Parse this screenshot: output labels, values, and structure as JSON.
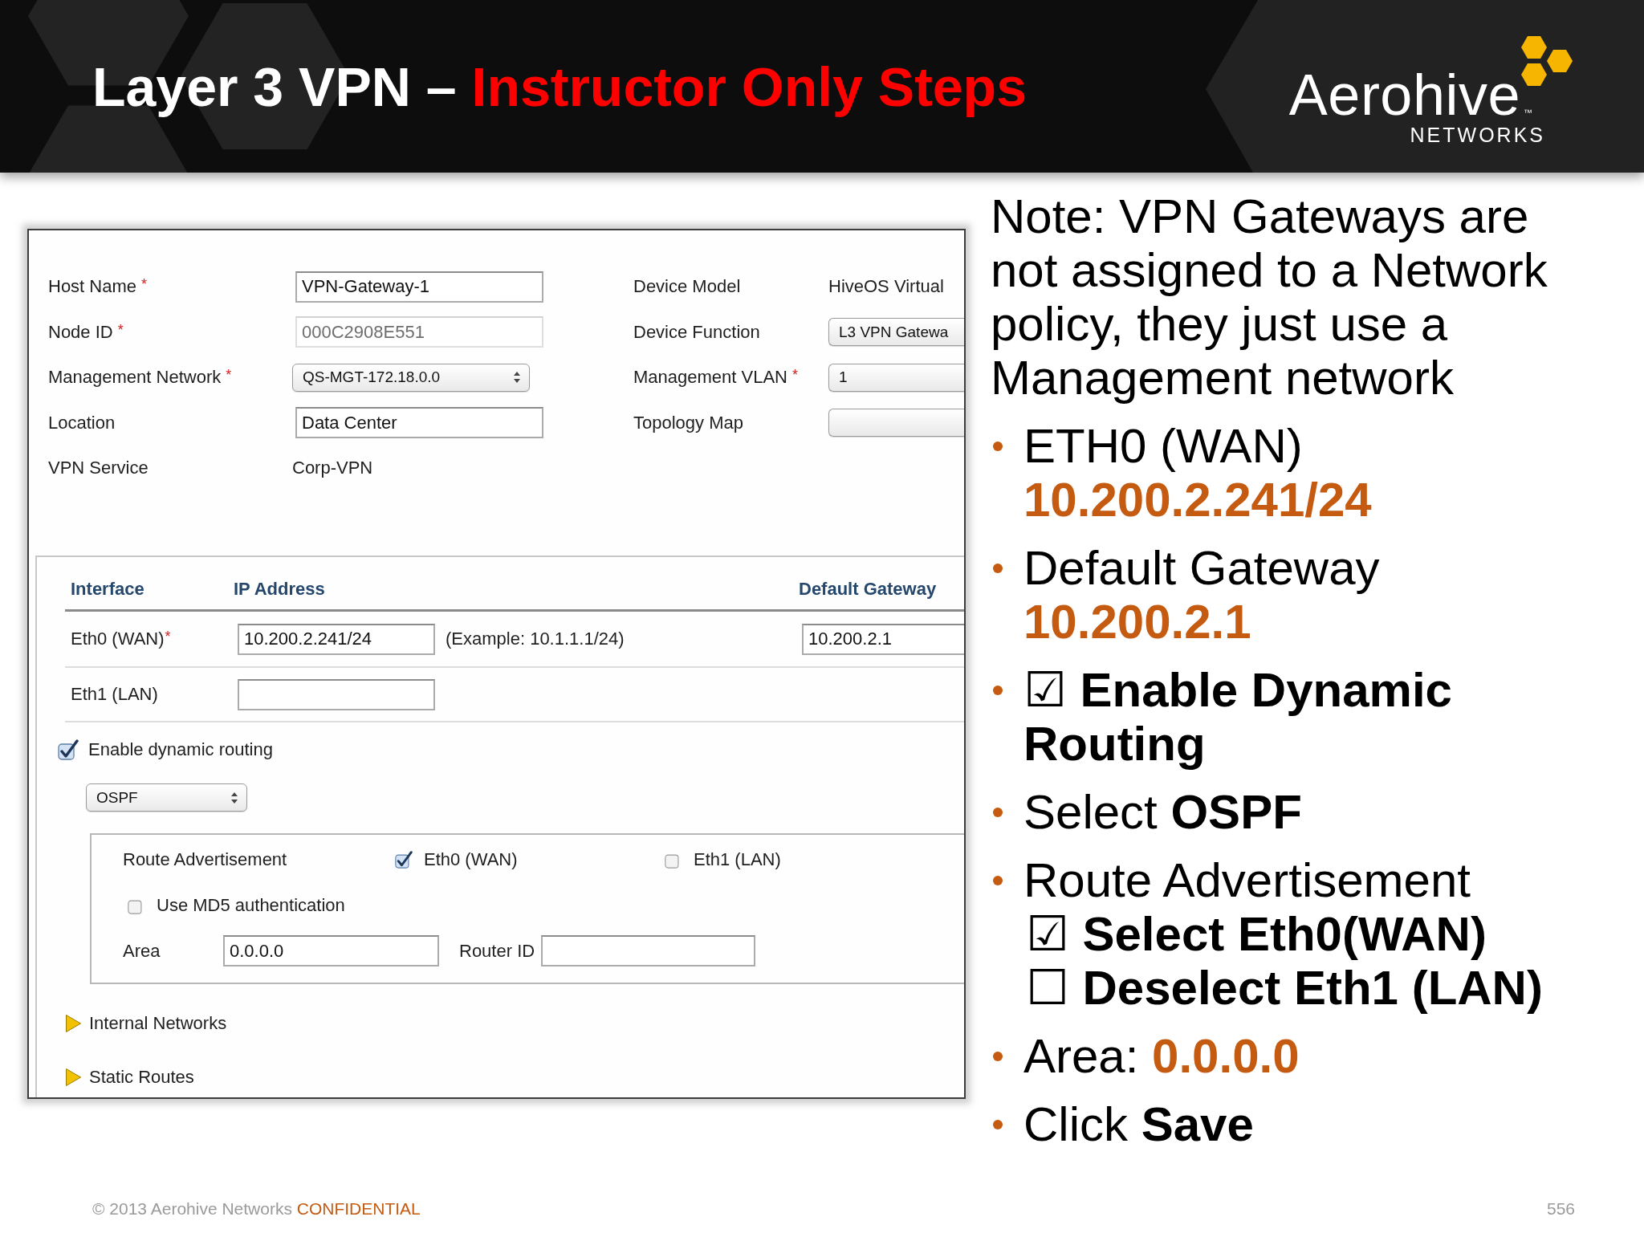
{
  "header": {
    "title": "Layer 3 VPN –",
    "highlight": "Instructor Only Steps"
  },
  "logo": {
    "name": "Aerohive",
    "trademark": "™",
    "subtitle": "NETWORKS"
  },
  "form": {
    "left_fields": [
      {
        "label": "Host Name",
        "required_mark": "*",
        "kind": "input",
        "value": "VPN-Gateway-1",
        "disabled": false
      },
      {
        "label": "Node ID",
        "required_mark": "*",
        "kind": "input",
        "value": "000C2908E551",
        "disabled": true
      },
      {
        "label": "Management Network",
        "required_mark": "*",
        "kind": "select",
        "value": "QS-MGT-172.18.0.0",
        "disabled": false
      },
      {
        "label": "Location",
        "kind": "input",
        "value": "Data Center",
        "disabled": false
      },
      {
        "label": "VPN Service",
        "kind": "text",
        "value": "Corp-VPN",
        "disabled": false
      }
    ],
    "right_fields": [
      {
        "label": "Device Model",
        "kind": "text",
        "value": "HiveOS Virtual",
        "disabled": false
      },
      {
        "label": "Device Function",
        "kind": "select",
        "value": "L3 VPN Gatewa",
        "disabled": false
      },
      {
        "label": "Management VLAN",
        "required_mark": "*",
        "kind": "select",
        "value": "1",
        "disabled": false
      },
      {
        "label": "Topology Map",
        "kind": "select",
        "disabled": false
      }
    ],
    "interfaces": {
      "columns": [
        "Interface",
        "IP Address",
        "Default Gateway"
      ],
      "rows": [
        {
          "kind": "wan",
          "name": "Eth0 (WAN)",
          "required_mark": "*",
          "ip": "10.200.2.241/24",
          "hint": "(Example: 10.1.1.1/24)",
          "gateway": "10.200.2.1"
        },
        {
          "kind": "lan",
          "name": "Eth1 (LAN)"
        }
      ]
    },
    "dynamic_routing": {
      "label": "Enable dynamic routing",
      "checked": true,
      "protocol": "OSPF",
      "route_advertisement": {
        "label": "Route Advertisement",
        "options": [
          {
            "label": "Eth0 (WAN)",
            "checked": true
          },
          {
            "label": "Eth1 (LAN)",
            "checked": false
          }
        ]
      },
      "md5": {
        "label": "Use MD5 authentication",
        "checked": false
      },
      "area": {
        "label": "Area",
        "value": "0.0.0.0"
      },
      "router_id": {
        "label": "Router ID"
      }
    },
    "sections": [
      {
        "label": "Internal Networks",
        "expanded": false
      },
      {
        "label": "Static Routes",
        "expanded": false
      }
    ]
  },
  "note": "Note: VPN Gateways are not assigned to a Network policy, they just use a Management network",
  "bullets": [
    {
      "kind": "value",
      "text": "ETH0 (WAN)",
      "value": "10.200.2.241/24"
    },
    {
      "kind": "value",
      "text": "Default Gateway",
      "value": "10.200.2.1"
    },
    {
      "kind": "bold",
      "text": "☑ Enable Dynamic Routing"
    },
    {
      "kind": "plain",
      "text": "Select **OSPF**"
    },
    {
      "kind": "list",
      "text": "Route Advertisement",
      "items": [
        "☑ Select Eth0(WAN)",
        "☐ Deselect Eth1 (LAN)"
      ]
    },
    {
      "kind": "accent",
      "text": "Area: **0.0.0.0**"
    },
    {
      "kind": "plain",
      "text": "Click **Save**"
    }
  ],
  "footer": {
    "copyright": "© 2013 Aerohive Networks",
    "label": "CONFIDENTIAL",
    "page": "556"
  }
}
